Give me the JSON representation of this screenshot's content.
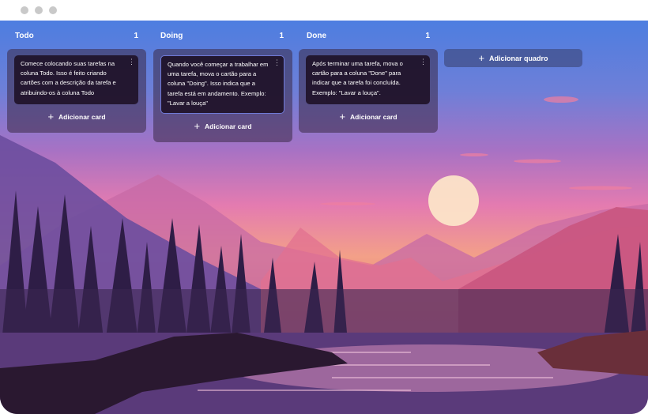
{
  "window": {
    "controls": [
      "dot-1",
      "dot-2",
      "dot-3"
    ]
  },
  "columns": [
    {
      "title": "Todo",
      "count": "1",
      "cards": [
        {
          "text": "Comece colocando suas tarefas na coluna Todo. Isso é feito criando cartões com a descrição da tarefa e atribuindo-os à coluna Todo"
        }
      ],
      "add_card_label": "Adicionar card"
    },
    {
      "title": "Doing",
      "count": "1",
      "cards": [
        {
          "text": "Quando você começar a trabalhar em uma tarefa, mova o cartão para a coluna \"Doing\". Isso indica que a tarefa está em andamento. Exemplo: \"Lavar a louça\""
        }
      ],
      "add_card_label": "Adicionar card"
    },
    {
      "title": "Done",
      "count": "1",
      "cards": [
        {
          "text": "Após terminar uma tarefa, mova o cartão para a coluna \"Done\" para indicar que a tarefa foi concluída. Exemplo: \"Lavar a louça\"."
        }
      ],
      "add_card_label": "Adicionar card"
    }
  ],
  "add_board_label": "Adicionar quadro",
  "icons": {
    "card_menu": "more-vertical-icon",
    "add": "plus-icon",
    "plus_glyph": "+",
    "menu_glyph": "⋮"
  }
}
